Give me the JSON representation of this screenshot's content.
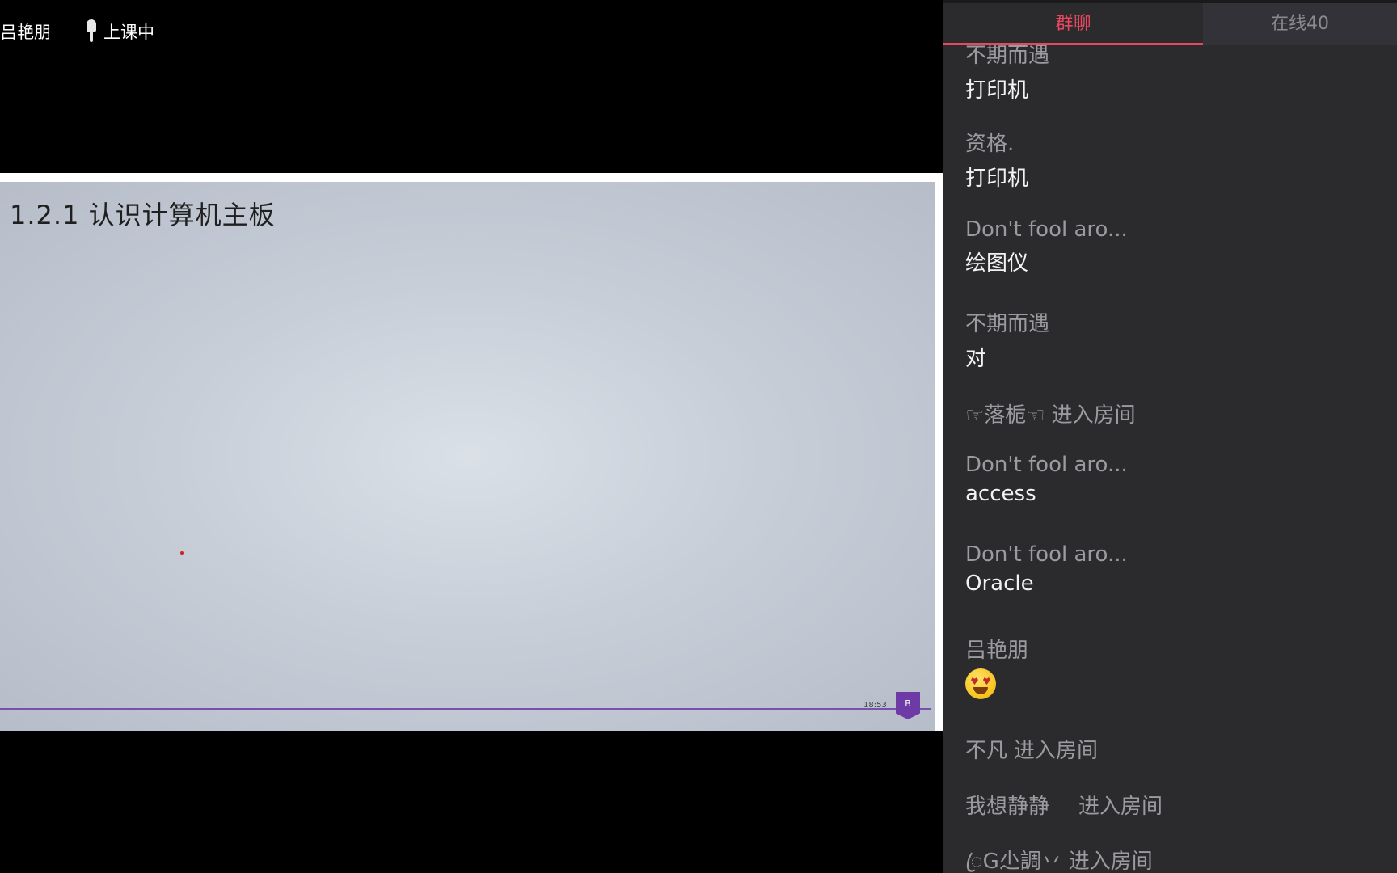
{
  "stage": {
    "teacher_name": "吕艳朋",
    "status_label": "上课中",
    "slide": {
      "title": "1.2.1 认识计算机主板",
      "timestamp": "18:53",
      "page_tag": "B"
    }
  },
  "panel": {
    "tabs": [
      {
        "label": "群聊",
        "active": true
      },
      {
        "label": "在线40",
        "active": false
      }
    ],
    "messages": [
      {
        "type": "chat",
        "name": "不期而遇",
        "text": "打印机"
      },
      {
        "type": "chat",
        "name": "资格.",
        "text": "打印机"
      },
      {
        "type": "chat",
        "name": "Don't fool aro...",
        "text": "绘图仪"
      },
      {
        "type": "chat",
        "name": "不期而遇",
        "text": "对"
      },
      {
        "type": "system",
        "name": "☞落栀☜",
        "action": "进入房间"
      },
      {
        "type": "chat",
        "name": "Don't fool aro...",
        "text": "access"
      },
      {
        "type": "chat",
        "name": "Don't fool aro...",
        "text": "Oracle"
      },
      {
        "type": "chat",
        "name": "吕艳朋",
        "emoji": "star-struck-emoji"
      },
      {
        "type": "system",
        "name": "不凡",
        "action": "进入房间"
      },
      {
        "type": "system",
        "name": "我想静静",
        "action": "进入房间"
      },
      {
        "type": "system",
        "name": "ꦿG尐調丷",
        "action": "进入房间"
      }
    ]
  },
  "colors": {
    "accent": "#e8475f",
    "panel_bg": "#2b2b2e",
    "slide_rule": "#7a4fb0"
  }
}
